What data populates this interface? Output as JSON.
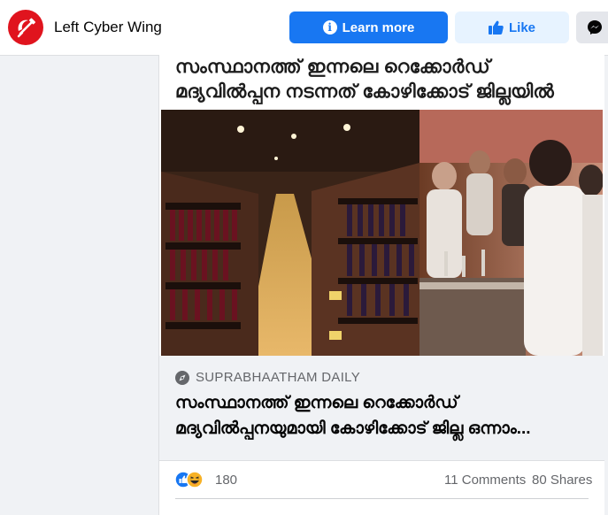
{
  "page": {
    "name": "Left Cyber Wing",
    "logo_icon": "hammer-sickle-icon",
    "brand_color": "#e0141e"
  },
  "actions": {
    "learn_more_label": "Learn more",
    "like_label": "Like",
    "accent_color": "#1877f2"
  },
  "post": {
    "title_lines": [
      "സംസ്ഥാനത്ത് ഇന്നലെ റെക്കോർഡ്",
      "മദ്യവിൽപ്പന നടന്നത് കോഴിക്കോട് ജില്ലയിൽ"
    ],
    "link": {
      "source": "SUPRABHAATHAM DAILY",
      "headline_lines": [
        "സംസ്ഥാനത്ത് ഇന്നലെ റെക്കോർഡ്",
        "മദ്യവിൽപ്പനയുമായി കോഴിക്കോട് ജില്ല ഒന്നാം..."
      ]
    },
    "reactions": {
      "count": "180",
      "types": [
        "like-icon",
        "haha-icon"
      ]
    },
    "comments": "11 Comments",
    "shares": "80 Shares"
  }
}
